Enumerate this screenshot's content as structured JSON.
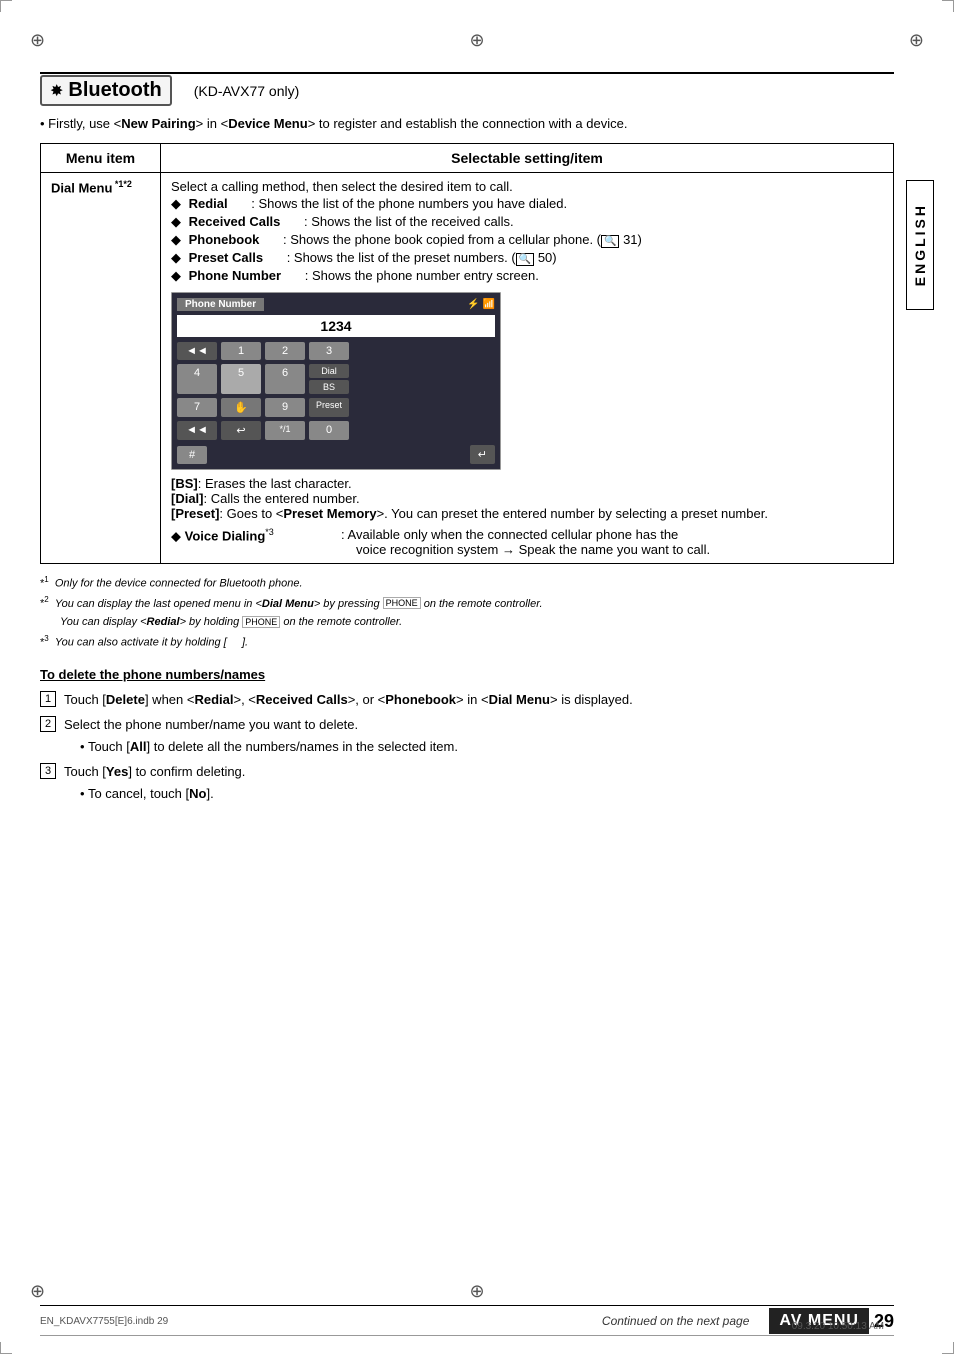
{
  "page": {
    "title": "Bluetooth",
    "subtitle": "(KD-AVX77 only)",
    "reg_marks": "⊕",
    "section": "ENGLISH",
    "av_menu": "AV MENU",
    "page_number": "29",
    "continued": "Continued on the next page",
    "filename": "EN_KDAVX7755[E]6.indb   29",
    "datetime": "09.3.20   10:50:13 AM"
  },
  "intro_note": "Firstly, use <New Pairing> in <Device Menu> to register and establish the connection with a device.",
  "table": {
    "header_col1": "Menu item",
    "header_col2": "Selectable setting/item",
    "row": {
      "menu_item": "Dial Menu",
      "sup1": "*1",
      "sup2": "*2",
      "intro": "Select a calling method, then select the desired item to call.",
      "items": [
        {
          "label": "Redial",
          "desc": "Shows the list of the phone numbers you have dialed."
        },
        {
          "label": "Received Calls",
          "desc": "Shows the list of the received calls."
        },
        {
          "label": "Phonebook",
          "desc": "Shows the phone book copied from a cellular phone. (  31)"
        },
        {
          "label": "Preset Calls",
          "desc": "Shows the list of the preset numbers. (  50)"
        },
        {
          "label": "Phone Number",
          "desc": "Shows the phone number entry screen."
        }
      ],
      "phone_ui": {
        "title": "Phone Number",
        "number": "1234",
        "keys_row1": [
          "◄◄",
          "1",
          "2",
          "3"
        ],
        "keys_row2": [
          "4",
          "5",
          "6",
          ""
        ],
        "keys_row3": [
          "7",
          "",
          "9",
          ""
        ],
        "keys_row4": [
          "◄◄",
          "↩",
          "*/1",
          "0",
          "#"
        ],
        "btn_dial": "Dial",
        "btn_bs": "BS",
        "btn_preset": "Preset",
        "btn_exit": "↵"
      },
      "descriptions": [
        {
          "key": "[BS]",
          "value": "Erases the last character."
        },
        {
          "key": "[Dial]",
          "value": "Calls the entered number."
        },
        {
          "key": "[Preset]",
          "value": "Goes to <Preset Memory>. You can preset the entered number by selecting a preset number."
        }
      ],
      "voice_dialing": {
        "label": "Voice Dialing",
        "sup": "*3",
        "desc1": "Available only when the connected cellular phone has the",
        "desc2": "voice recognition system → Speak the name you want to call."
      }
    }
  },
  "footnotes": [
    {
      "num": "*1",
      "text": "Only for the device connected for Bluetooth phone."
    },
    {
      "num": "*2",
      "text": "You can display the last opened menu in <Dial Menu> by pressing  on the remote controller."
    },
    {
      "num": "*2b",
      "text": "You can display <Redial> by holding  on the remote controller."
    },
    {
      "num": "*3",
      "text": "You can also activate it by holding [   ]."
    }
  ],
  "delete_section": {
    "title": "To delete the phone numbers/names",
    "steps": [
      {
        "num": "1",
        "text": "Touch [Delete] when <Redial>, <Received Calls>, or <Phonebook> in <Dial Menu> is displayed."
      },
      {
        "num": "2",
        "text": "Select the phone number/name you want to delete.",
        "sub": "Touch [All] to delete all the numbers/names in the selected item."
      },
      {
        "num": "3",
        "text": "Touch [Yes] to confirm deleting.",
        "sub": "To cancel, touch [No]."
      }
    ]
  },
  "icons": {
    "bluetooth": "✱",
    "bullet": "◆",
    "phone": "📞",
    "search": "🔍"
  }
}
